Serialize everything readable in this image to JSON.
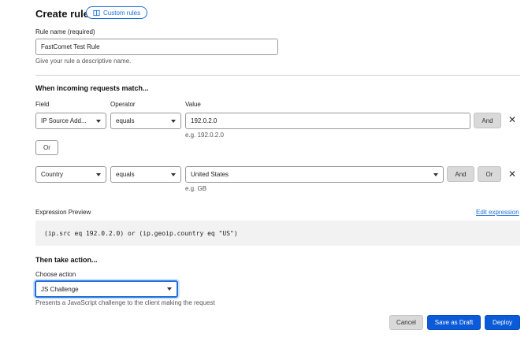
{
  "header": {
    "title": "Create rule",
    "custom_rules_label": "Custom rules"
  },
  "rule_name": {
    "label": "Rule name (required)",
    "value": "FastComet Test Rule",
    "hint": "Give your rule a descriptive name."
  },
  "match": {
    "heading": "When incoming requests match...",
    "col_field": "Field",
    "col_operator": "Operator",
    "col_value": "Value",
    "rows": [
      {
        "field": "IP Source Add...",
        "operator": "equals",
        "value": "192.0.2.0",
        "example": "e.g. 192.0.2.0",
        "and_label": "And"
      },
      {
        "field": "Country",
        "operator": "equals",
        "value": "United States",
        "example": "e.g. GB",
        "and_label": "And",
        "or_label": "Or"
      }
    ],
    "or_button_label": "Or"
  },
  "expression": {
    "label": "Expression Preview",
    "edit_link": "Edit expression",
    "text": "(ip.src eq 192.0.2.0) or (ip.geoip.country eq \"US\")"
  },
  "action": {
    "heading": "Then take action...",
    "label": "Choose action",
    "value": "JS Challenge",
    "description": "Presents a JavaScript challenge to the client making the request"
  },
  "footer": {
    "cancel_label": "Cancel",
    "save_draft_label": "Save as Draft",
    "deploy_label": "Deploy"
  },
  "colors": {
    "accent": "#0b5ad8",
    "link": "#1e6fd9"
  }
}
